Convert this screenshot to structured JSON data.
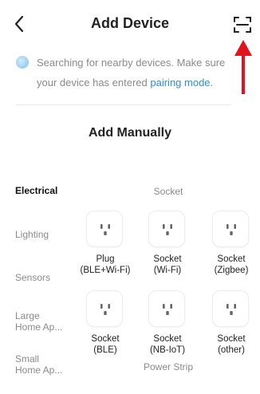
{
  "header": {
    "title": "Add Device"
  },
  "notice": {
    "text": "Searching for nearby devices. Make sure your device has entered ",
    "link": "pairing mode",
    "end": "."
  },
  "section": {
    "title": "Add Manually"
  },
  "categories": [
    {
      "label": "Electrical",
      "active": true
    },
    {
      "label": "Lighting",
      "active": false
    },
    {
      "label": "Sensors",
      "active": false
    },
    {
      "label_line1": "Large",
      "label_line2": "Home Ap..."
    },
    {
      "label_line1": "Small",
      "label_line2": "Home Ap..."
    }
  ],
  "groups": {
    "socket": "Socket",
    "power_strip": "Power Strip"
  },
  "devices": [
    {
      "line1": "Plug",
      "line2": "(BLE+Wi-Fi)",
      "icon": "socket-icon"
    },
    {
      "line1": "Socket",
      "line2": "(Wi-Fi)",
      "icon": "socket-icon"
    },
    {
      "line1": "Socket",
      "line2": "(Zigbee)",
      "icon": "socket-icon"
    },
    {
      "line1": "Socket",
      "line2": "(BLE)",
      "icon": "socket-icon"
    },
    {
      "line1": "Socket",
      "line2": "(NB-IoT)",
      "icon": "socket-icon"
    },
    {
      "line1": "Socket",
      "line2": "(other)",
      "icon": "socket-icon"
    }
  ],
  "icons": {
    "back": "chevron-left-icon",
    "scan": "scan-icon",
    "annotation": "red-arrow-icon"
  },
  "colors": {
    "link": "#2d8be0",
    "muted": "#8a8a8a",
    "annotation": "#e0141e"
  }
}
